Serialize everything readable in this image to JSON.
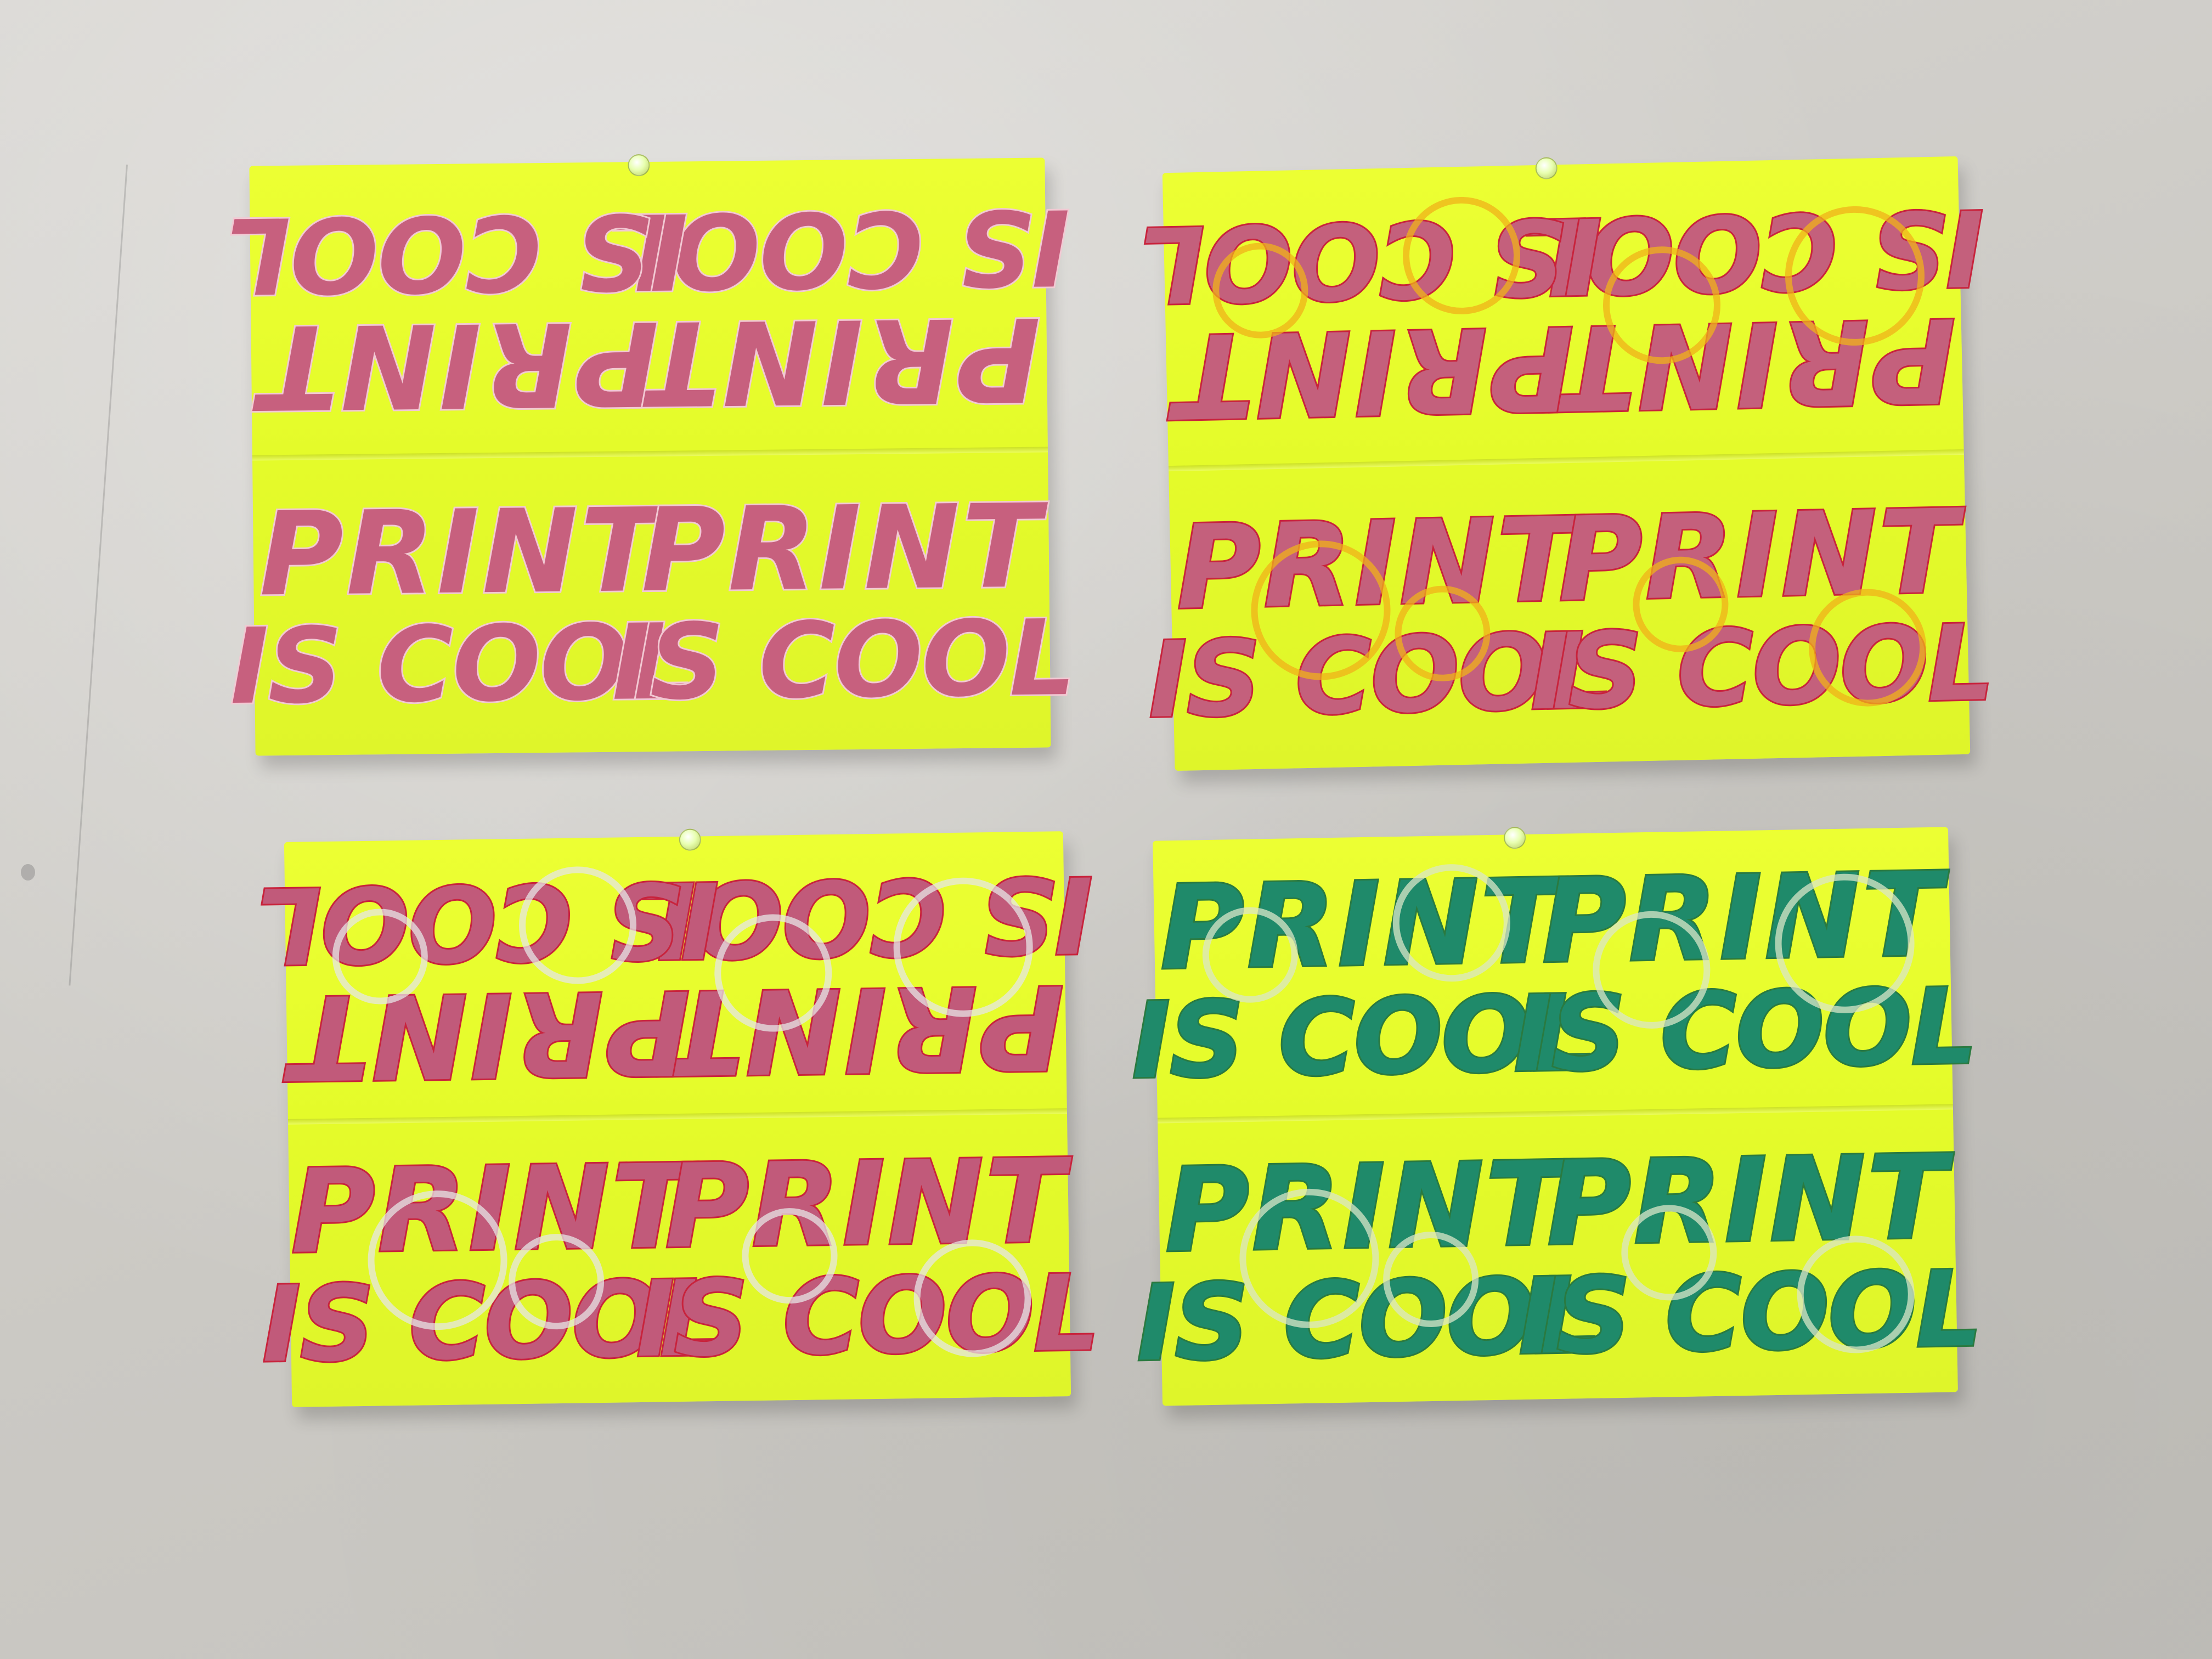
{
  "scene": {
    "wall_color": "#cfcdc8",
    "paper_color": "#e8fd2e"
  },
  "posters": [
    {
      "id": "top-left",
      "ink": "#c7607e",
      "outline": "#f2c9d3",
      "swirl_color": "",
      "top": {
        "line1": "PRINT",
        "line2": "IS COOL"
      },
      "bottom": {
        "line1": "PRINT",
        "line2": "IS COOL"
      }
    },
    {
      "id": "top-right",
      "ink": "#c4607c",
      "outline": "#c8233c",
      "swirl_color": "#f0b21a",
      "top": {
        "line1": "PRINT",
        "line2": "IS COOL"
      },
      "bottom": {
        "line1": "PRINT",
        "line2": "IS COOL"
      }
    },
    {
      "id": "bottom-left",
      "ink": "#c15a7a",
      "outline": "#c8233c",
      "swirl_color": "#e6e6e6",
      "top": {
        "line1": "PRINT",
        "line2": "IS COOL"
      },
      "bottom": {
        "line1": "PRINT",
        "line2": "IS COOL"
      }
    },
    {
      "id": "bottom-right",
      "ink": "#1f8a6a",
      "outline": "#2a7a40",
      "swirl_color": "#d9e6c8",
      "top": {
        "line1": "PRINT",
        "line2": "IS COOL"
      },
      "bottom": {
        "line1": "PRINT",
        "line2": "IS COOL"
      }
    }
  ]
}
